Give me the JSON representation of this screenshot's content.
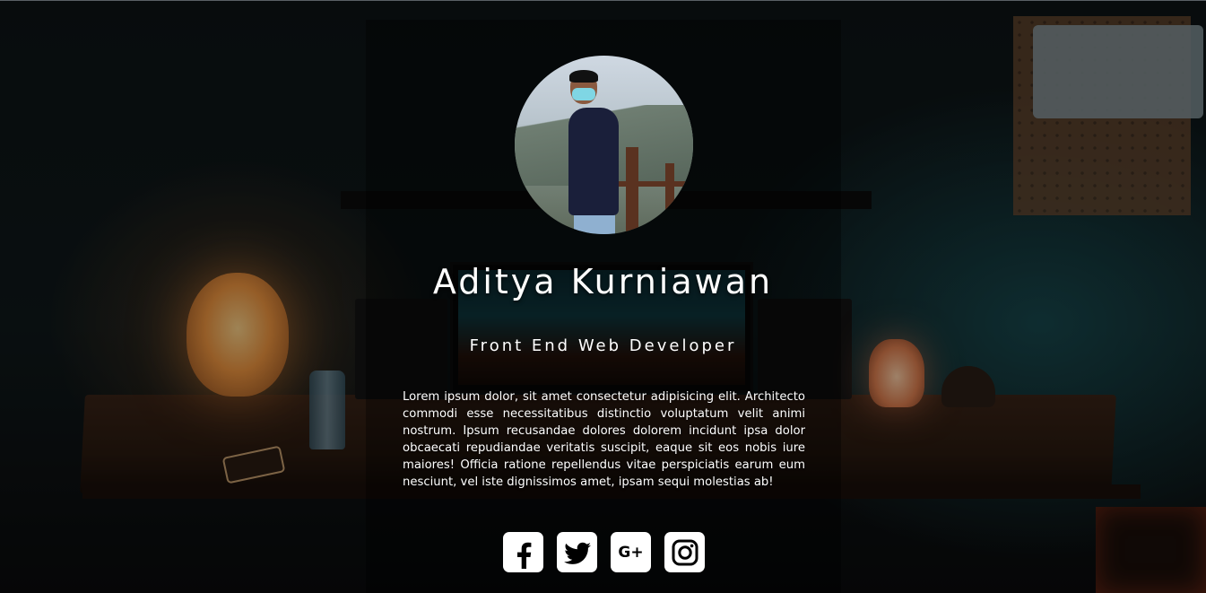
{
  "profile": {
    "name": "Aditya Kurniawan",
    "role": "Front End Web Developer",
    "bio": "Lorem ipsum dolor, sit amet consectetur adipisicing elit. Architecto commodi esse necessitatibus distinctio voluptatum velit animi nostrum. Ipsum recusandae dolores dolorem incidunt ipsa dolor obcaecati repudiandae veritatis suscipit, eaque sit eos nobis iure maiores! Officia ratione repellendus vitae perspiciatis earum eum nesciunt, vel iste dignissimos amet, ipsam sequi molestias ab!",
    "avatar_icon": "profile-photo"
  },
  "socials": [
    {
      "icon": "facebook-icon"
    },
    {
      "icon": "twitter-icon"
    },
    {
      "icon": "google-plus-icon",
      "label": "G+"
    },
    {
      "icon": "instagram-icon"
    }
  ],
  "colors": {
    "text": "#ffffff",
    "icon_bg": "#ffffff",
    "icon_fg": "#000000"
  }
}
